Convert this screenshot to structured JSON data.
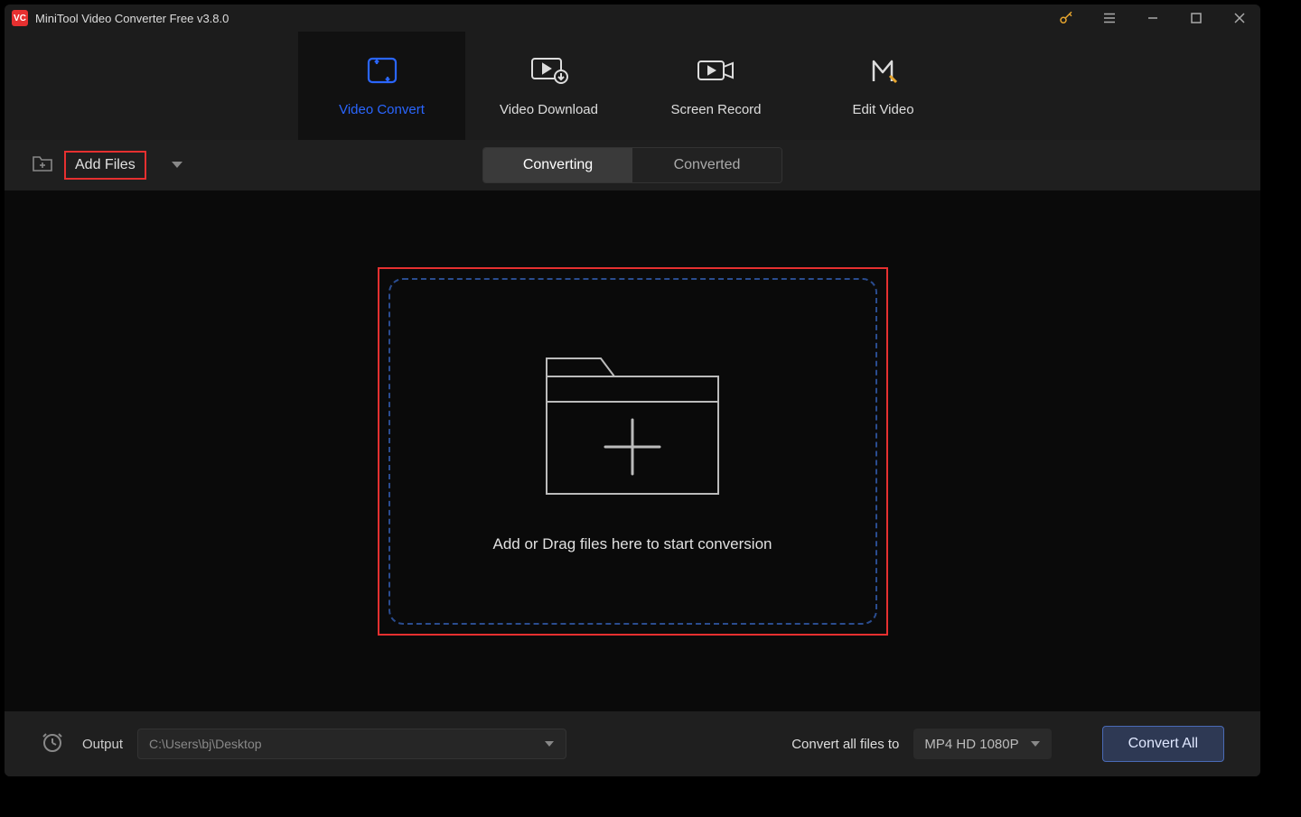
{
  "titlebar": {
    "app_icon_text": "VC",
    "title": "MiniTool Video Converter Free v3.8.0"
  },
  "nav": {
    "video_convert": "Video Convert",
    "video_download": "Video Download",
    "screen_record": "Screen Record",
    "edit_video": "Edit Video"
  },
  "toolbar": {
    "add_files": "Add Files",
    "sub_converting": "Converting",
    "sub_converted": "Converted"
  },
  "dropzone": {
    "hint": "Add or Drag files here to start conversion"
  },
  "footer": {
    "output_label": "Output",
    "output_path": "C:\\Users\\bj\\Desktop",
    "convert_all_label": "Convert all files to",
    "format_selected": "MP4 HD 1080P",
    "convert_all_btn": "Convert All"
  }
}
